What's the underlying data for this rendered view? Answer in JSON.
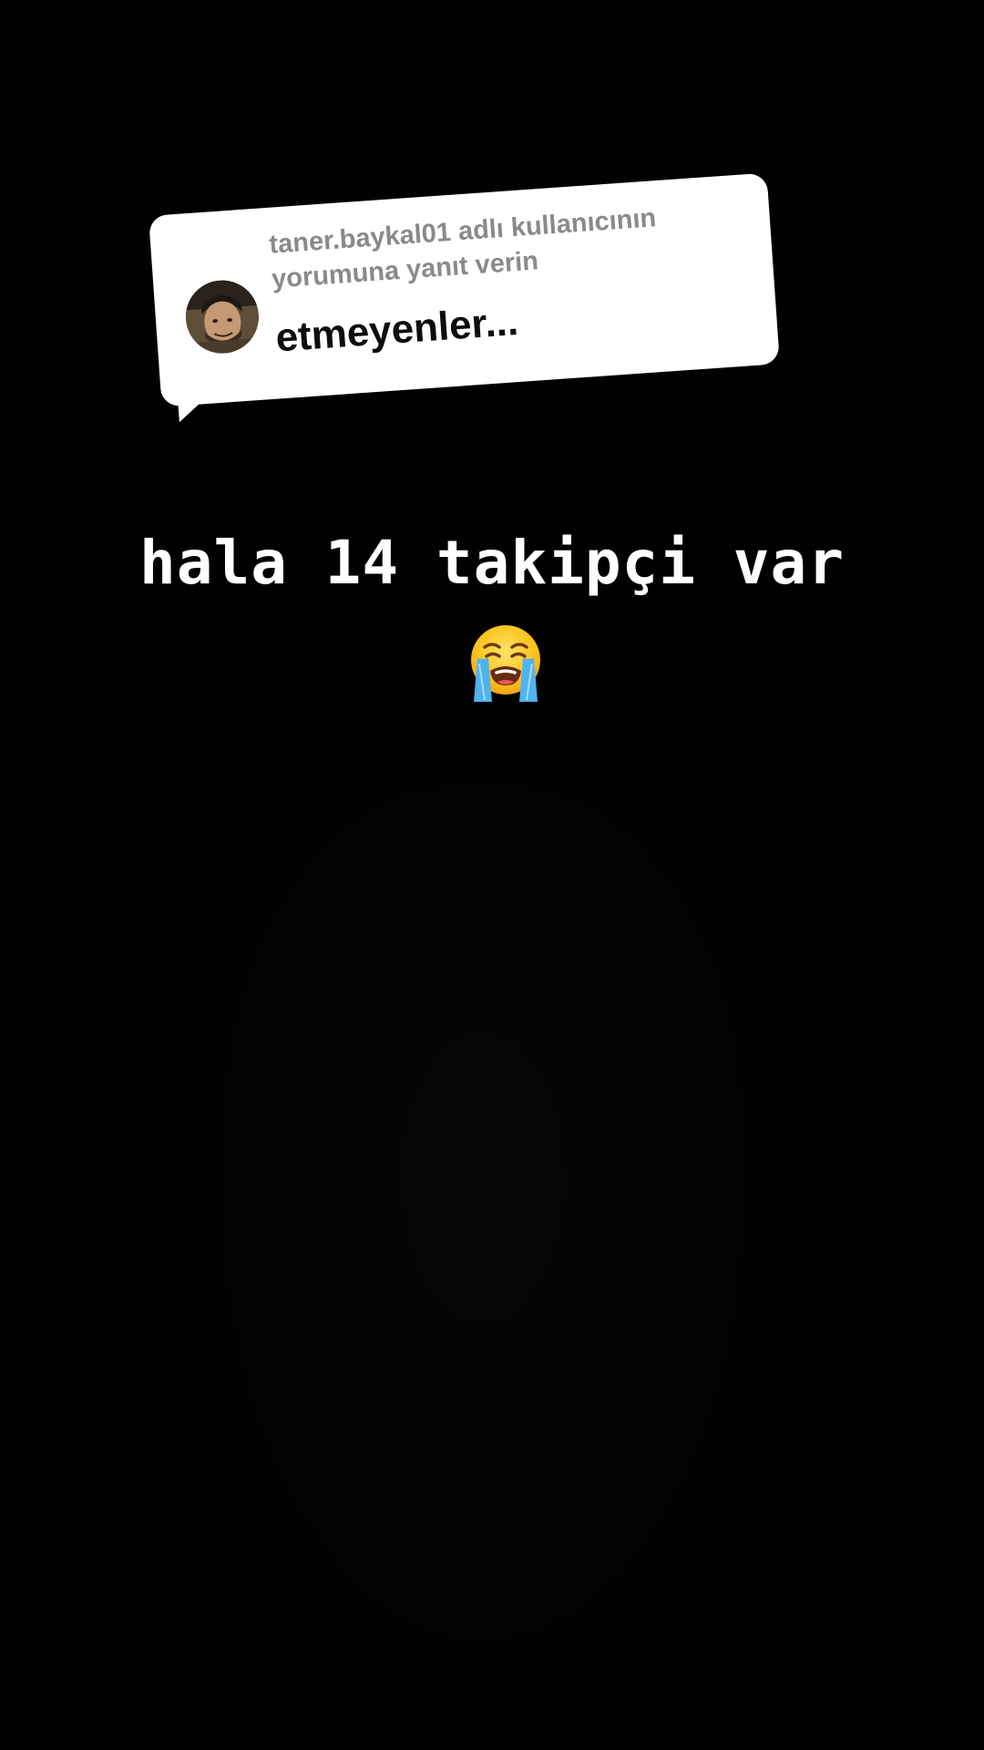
{
  "reply_card": {
    "label": "taner.baykal01 adlı kullanıcının yorumuna yanıt verin",
    "comment": "etmeyenler..."
  },
  "caption": {
    "text": "hala 14 takipçi var"
  },
  "icons": {
    "avatar": "user-avatar-photo",
    "emoji": "loudly-crying-face-emoji"
  },
  "colors": {
    "background": "#000000",
    "card": "#ffffff",
    "label": "#8a8a8a",
    "comment": "#0d0d0d",
    "caption": "#ffffff"
  }
}
